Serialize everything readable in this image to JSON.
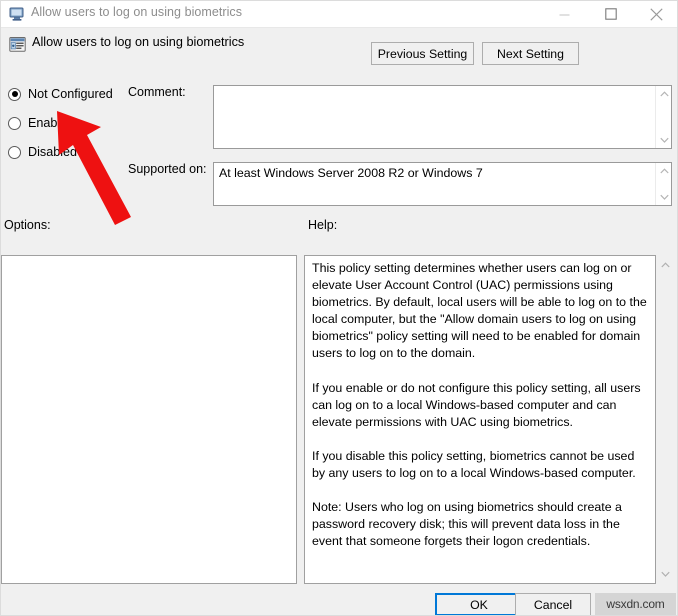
{
  "window": {
    "title": "Allow users to log on using biometrics",
    "icon": "monitor-icon",
    "minimize_label": "Minimize",
    "maximize_label": "Maximize",
    "close_label": "Close"
  },
  "header": {
    "icon": "policy-setting-icon",
    "title": "Allow users to log on using biometrics",
    "previous_setting_label": "Previous Setting",
    "next_setting_label": "Next Setting"
  },
  "state": {
    "selected": "Not Configured",
    "options": [
      {
        "label": "Not Configured",
        "checked": true
      },
      {
        "label": "Enabled",
        "checked": false
      },
      {
        "label": "Disabled",
        "checked": false
      }
    ]
  },
  "comment": {
    "label": "Comment:",
    "value": "",
    "placeholder": ""
  },
  "supported_on": {
    "label": "Supported on:",
    "value": "At least Windows Server 2008 R2 or Windows 7"
  },
  "panes": {
    "options_label": "Options:",
    "options_content": "",
    "help_label": "Help:",
    "help_paragraphs": [
      "This policy setting determines whether users can log on or elevate User Account Control (UAC) permissions using biometrics.  By default, local users will be able to log on to the local computer, but the \"Allow domain users to log on using biometrics\" policy setting will need to be enabled for domain users to log on to the domain.",
      "If you enable or do not configure this policy setting, all users can log on to a local Windows-based computer and can elevate permissions with UAC using biometrics.",
      "If you disable this policy setting, biometrics cannot be used by any users to log on to a local Windows-based computer.",
      "Note: Users who log on using biometrics should create a password recovery disk; this will prevent data loss in the event that someone forgets their logon credentials."
    ]
  },
  "footer": {
    "ok_label": "OK",
    "cancel_label": "Cancel",
    "watermark": "wsxdn.com"
  },
  "annotation": {
    "type": "red-arrow",
    "points_to": "Enabled",
    "color": "#ee1111"
  },
  "colors": {
    "window_background": "#f0f0f0",
    "field_background": "#ffffff",
    "accent": "#0078d7",
    "annotation_red": "#ee1111",
    "title_text": "#8d8d8d"
  }
}
